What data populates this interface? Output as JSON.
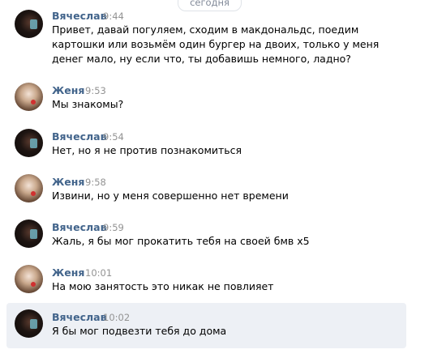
{
  "date_divider": "сегодня",
  "messages": [
    {
      "author": "Вячеслав",
      "time": "9:44",
      "text": "Привет, давай погуляем, сходим в макдональдс, поедим\nкартошки или возьмём один бургер на двоих, только у меня\nденег мало, ну если что, ты добавишь немного, ладно?"
    },
    {
      "author": "Женя",
      "time": "9:53",
      "text": "Мы знакомы?"
    },
    {
      "author": "Вячеслав",
      "time": "9:54",
      "text": "Нет, но я не против познакомиться"
    },
    {
      "author": "Женя",
      "time": "9:58",
      "text": "Извини, но у меня совершенно нет времени"
    },
    {
      "author": "Вячеслав",
      "time": "9:59",
      "text": "Жаль, я бы мог прокатить тебя на своей бмв x5"
    },
    {
      "author": "Женя",
      "time": "10:01",
      "text": "На мою занятость это никак не повлияет"
    },
    {
      "author": "Вячеслав",
      "time": "10:02",
      "text": "Я бы мог подвезти тебя до дома"
    }
  ]
}
